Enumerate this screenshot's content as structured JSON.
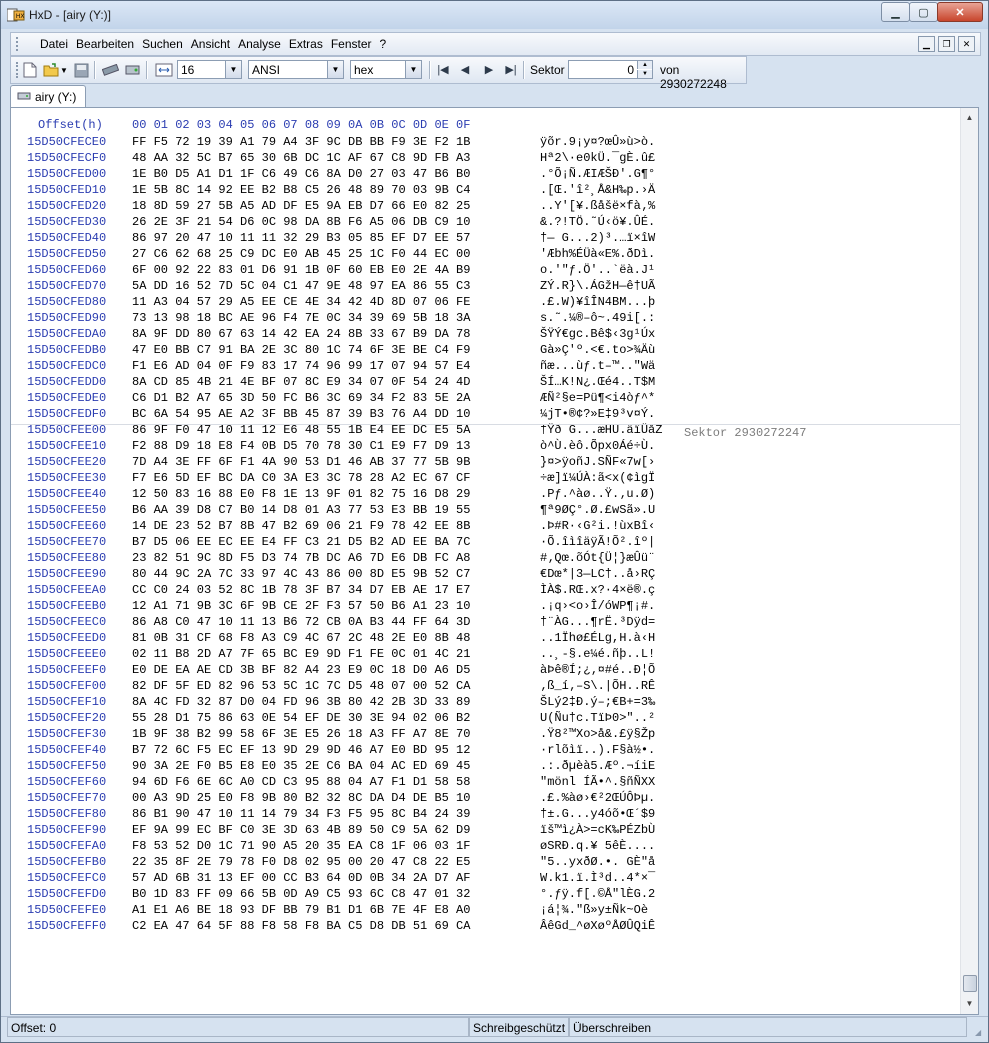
{
  "window": {
    "title": "HxD - [airy (Y:)]"
  },
  "menu": [
    "Datei",
    "Bearbeiten",
    "Suchen",
    "Ansicht",
    "Analyse",
    "Extras",
    "Fenster",
    "?"
  ],
  "toolbar": {
    "bytes_per_row": "16",
    "charset": "ANSI",
    "offset_base": "hex",
    "sector_label": "Sektor",
    "sector_value": "0",
    "sector_total": "von 2930272248"
  },
  "tab": {
    "label": "airy (Y:)"
  },
  "editor": {
    "header_offset": "Offset(h)",
    "header_columns": "00 01 02 03 04 05 06 07 08 09 0A 0B 0C 0D 0E 0F",
    "sector_marker": "Sektor 2930272247",
    "rows": [
      {
        "o": "15D50CFECE0",
        "h": "FF F5 72 19 39 A1 79 A4 3F 9C DB BB F9 3E F2 1B",
        "t": "ÿõr.9¡y¤?œÛ»ù>ò."
      },
      {
        "o": "15D50CFECF0",
        "h": "48 AA 32 5C B7 65 30 6B DC 1C AF 67 C8 9D FB A3",
        "t": "Hª2\\·e0kÜ.¯gÈ.û£"
      },
      {
        "o": "15D50CFED00",
        "h": "1E B0 D5 A1 D1 1F C6 49 C6 8A D0 27 03 47 B6 B0",
        "t": ".°Õ¡Ñ.ÆIÆŠÐ'.G¶°"
      },
      {
        "o": "15D50CFED10",
        "h": "1E 5B 8C 14 92 EE B2 B8 C5 26 48 89 70 03 9B C4",
        "t": ".[Œ.'î²¸Å&H‰p.›Ä"
      },
      {
        "o": "15D50CFED20",
        "h": "18 8D 59 27 5B A5 AD DF E5 9A EB D7 66 E0 82 25",
        "t": "..Y'[¥.ßåšë×fà‚%"
      },
      {
        "o": "15D50CFED30",
        "h": "26 2E 3F 21 54 D6 0C 98 DA 8B F6 A5 06 DB C9 10",
        "t": "&.?!TÖ.˜Ú‹ö¥.ÛÉ."
      },
      {
        "o": "15D50CFED40",
        "h": "86 97 20 47 10 11 11 32 29 B3 05 85 EF D7 EE 57",
        "t": "†— G...2)³.…ï×îW"
      },
      {
        "o": "15D50CFED50",
        "h": "27 C6 62 68 25 C9 DC E0 AB 45 25 1C F0 44 EC 00",
        "t": "'Æbh%ÉÜà«E%.ðDì."
      },
      {
        "o": "15D50CFED60",
        "h": "6F 00 92 22 83 01 D6 91 1B 0F 60 EB E0 2E 4A B9",
        "t": "o.'\"ƒ.Ö'..`ëà.J¹"
      },
      {
        "o": "15D50CFED70",
        "h": "5A DD 16 52 7D 5C 04 C1 47 9E 48 97 EA 86 55 C3",
        "t": "ZÝ.R}\\.ÁGžH—ê†UÃ"
      },
      {
        "o": "15D50CFED80",
        "h": "11 A3 04 57 29 A5 EE CE 4E 34 42 4D 8D 07 06 FE",
        "t": ".£.W)¥îÎN4BM...þ"
      },
      {
        "o": "15D50CFED90",
        "h": "73 13 98 18 BC AE 96 F4 7E 0C 34 39 69 5B 18 3A",
        "t": "s.˜.¼®–ô~.49i[.:"
      },
      {
        "o": "15D50CFEDA0",
        "h": "8A 9F DD 80 67 63 14 42 EA 24 8B 33 67 B9 DA 78",
        "t": "ŠŸÝ€gc.Bê$‹3g¹Úx"
      },
      {
        "o": "15D50CFEDB0",
        "h": "47 E0 BB C7 91 BA 2E 3C 80 1C 74 6F 3E BE C4 F9",
        "t": "Gà»Ç'º.<€.to>¾Äù"
      },
      {
        "o": "15D50CFEDC0",
        "h": "F1 E6 AD 04 0F F9 83 17 74 96 99 17 07 94 57 E4",
        "t": "ñæ...ùƒ.t–™..\"Wä"
      },
      {
        "o": "15D50CFEDD0",
        "h": "8A CD 85 4B 21 4E BF 07 8C E9 34 07 0F 54 24 4D",
        "t": "ŠÍ…K!N¿.Œé4..T$M"
      },
      {
        "o": "15D50CFEDE0",
        "h": "C6 D1 B2 A7 65 3D 50 FC B6 3C 69 34 F2 83 5E 2A",
        "t": "ÆÑ²§e=Pü¶<i4òƒ^*"
      },
      {
        "o": "15D50CFEDF0",
        "h": "BC 6A 54 95 AE A2 3F BB 45 87 39 B3 76 A4 DD 10",
        "t": "¼jT•®¢?»E‡9³v¤Ý."
      },
      {
        "o": "15D50CFEE00",
        "h": "86 9F F0 47 10 11 12 E6 48 55 1B E4 EE DC E5 5A",
        "t": "†Ÿð G...æHU.äîÜåZ"
      },
      {
        "o": "15D50CFEE10",
        "h": "F2 88 D9 18 E8 F4 0B D5 70 78 30 C1 E9 F7 D9 13",
        "t": "ò^Ù.èô.Õpx0Áé÷Ù."
      },
      {
        "o": "15D50CFEE20",
        "h": "7D A4 3E FF 6F F1 4A 90 53 D1 46 AB 37 77 5B 9B",
        "t": "}¤>ÿoñJ.SÑF«7w[›"
      },
      {
        "o": "15D50CFEE30",
        "h": "F7 E6 5D EF BC DA C0 3A E3 3C 78 28 A2 EC 67 CF",
        "t": "÷æ]ï¼ÚÀ:ã<x(¢ìgÏ"
      },
      {
        "o": "15D50CFEE40",
        "h": "12 50 83 16 88 E0 F8 1E 13 9F 01 82 75 16 D8 29",
        "t": ".Pƒ.^àø..Ÿ.‚u.Ø)"
      },
      {
        "o": "15D50CFEE50",
        "h": "B6 AA 39 D8 C7 B0 14 D8 01 A3 77 53 E3 BB 19 55",
        "t": "¶ª9ØÇ°.Ø.£wSã».U"
      },
      {
        "o": "15D50CFEE60",
        "h": "14 DE 23 52 B7 8B 47 B2 69 06 21 F9 78 42 EE 8B",
        "t": ".Þ#R·‹G²i.!ùxBî‹"
      },
      {
        "o": "15D50CFEE70",
        "h": "B7 D5 06 EE EC EE E4 FF C3 21 D5 B2 AD EE BA 7C",
        "t": "·Õ.îìîäÿÃ!Õ².îº|"
      },
      {
        "o": "15D50CFEE80",
        "h": "23 82 51 9C 8D F5 D3 74 7B DC A6 7D E6 DB FC A8",
        "t": "#‚Qœ.õÓt{Ü¦}æÛü¨"
      },
      {
        "o": "15D50CFEE90",
        "h": "80 44 9C 2A 7C 33 97 4C 43 86 00 8D E5 9B 52 C7",
        "t": "€Dœ*|3—LC†..å›RÇ"
      },
      {
        "o": "15D50CFEEA0",
        "h": "CC C0 24 03 52 8C 1B 78 3F B7 34 D7 EB AE 17 E7",
        "t": "ÌÀ$.RŒ.x?·4×ë®.ç"
      },
      {
        "o": "15D50CFEEB0",
        "h": "12 A1 71 9B 3C 6F 9B CE 2F F3 57 50 B6 A1 23 10",
        "t": ".¡q›<o›Î/óWP¶¡#."
      },
      {
        "o": "15D50CFEEC0",
        "h": "86 A8 C0 47 10 11 13 B6 72 CB 0A B3 44 FF 64 3D",
        "t": "†¨ÀG...¶rË.³Dÿd="
      },
      {
        "o": "15D50CFEED0",
        "h": "81 0B 31 CF 68 F8 A3 C9 4C 67 2C 48 2E E0 8B 48",
        "t": "..1Ïhø£ÉLg,H.à‹H"
      },
      {
        "o": "15D50CFEEE0",
        "h": "02 11 B8 2D A7 7F 65 BC E9 9D F1 FE 0C 01 4C 21",
        "t": "..¸-§.e¼é.ñþ..L!"
      },
      {
        "o": "15D50CFEEF0",
        "h": "E0 DE EA AE CD 3B BF 82 A4 23 E9 0C 18 D0 A6 D5",
        "t": "àÞê®Í;¿‚¤#é..Ð¦Õ"
      },
      {
        "o": "15D50CFEF00",
        "h": "82 DF 5F ED 82 96 53 5C 1C 7C D5 48 07 00 52 CA",
        "t": "‚ß_í‚–S\\.|ÕH..RÊ"
      },
      {
        "o": "15D50CFEF10",
        "h": "8A 4C FD 32 87 D0 04 FD 96 3B 80 42 2B 3D 33 89",
        "t": "ŠLý2‡Ð.ý–;€B+=3‰"
      },
      {
        "o": "15D50CFEF20",
        "h": "55 28 D1 75 86 63 0E 54 EF DE 30 3E 94 02 06 B2",
        "t": "U(Ñu†c.TïÞ0>\"..²"
      },
      {
        "o": "15D50CFEF30",
        "h": "1B 9F 38 B2 99 58 6F 3E E5 26 18 A3 FF A7 8E 70",
        "t": ".Ÿ8²™Xo>å&.£ÿ§Žp"
      },
      {
        "o": "15D50CFEF40",
        "h": "B7 72 6C F5 EC EF 13 9D 29 9D 46 A7 E0 BD 95 12",
        "t": "·rlõìï..).F§à½•."
      },
      {
        "o": "15D50CFEF50",
        "h": "90 3A 2E F0 B5 E8 E0 35 2E C6 BA 04 AC ED 69 45",
        "t": ".:.ðµèà5.Æº.¬íiE"
      },
      {
        "o": "15D50CFEF60",
        "h": "94 6D F6 6E 6C A0 CD C3 95 88 04 A7 F1 D1 58 58",
        "t": "\"mönl ÍÃ•^.§ñÑXX"
      },
      {
        "o": "15D50CFEF70",
        "h": "00 A3 9D 25 E0 F8 9B 80 B2 32 8C DA D4 DE B5 10",
        "t": ".£.%àø›€²2ŒÚÔÞµ."
      },
      {
        "o": "15D50CFEF80",
        "h": "86 B1 90 47 10 11 14 79 34 F3 F5 95 8C B4 24 39",
        "t": "†±.G...y4óõ•Œ´$9"
      },
      {
        "o": "15D50CFEF90",
        "h": "EF 9A 99 EC BF C0 3E 3D 63 4B 89 50 C9 5A 62 D9",
        "t": "ïš™ì¿À>=cK‰PÉZbÙ"
      },
      {
        "o": "15D50CFEFA0",
        "h": "F8 53 52 D0 1C 71 90 A5 20 35 EA C8 1F 06 03 1F",
        "t": "øSRÐ.q.¥ 5êÈ...."
      },
      {
        "o": "15D50CFEFB0",
        "h": "22 35 8F 2E 79 78 F0 D8 02 95 00 20 47 C8 22 E5",
        "t": "\"5..yxðØ.•. GÈ\"å"
      },
      {
        "o": "15D50CFEFC0",
        "h": "57 AD 6B 31 13 EF 00 CC B3 64 0D 0B 34 2A D7 AF",
        "t": "W.k1.ï.Ì³d..4*×¯"
      },
      {
        "o": "15D50CFEFD0",
        "h": "B0 1D 83 FF 09 66 5B 0D A9 C5 93 6C C8 47 01 32",
        "t": "°.ƒÿ.f[.©Å\"lÈG.2"
      },
      {
        "o": "15D50CFEFE0",
        "h": "A1 E1 A6 BE 18 93 DF BB 79 B1 D1 6B 7E 4F E8 A0",
        "t": "¡á¦¾.\"ß»y±Ñk~Oè "
      },
      {
        "o": "15D50CFEFF0",
        "h": "C2 EA 47 64 5F 88 F8 58 F8 BA C5 D8 DB 51 69 CA",
        "t": "ÂêGd_^øXøºÅØÛQiÊ"
      }
    ]
  },
  "status": {
    "offset": "Offset: 0",
    "readonly": "Schreibgeschützt",
    "mode": "Überschreiben"
  }
}
